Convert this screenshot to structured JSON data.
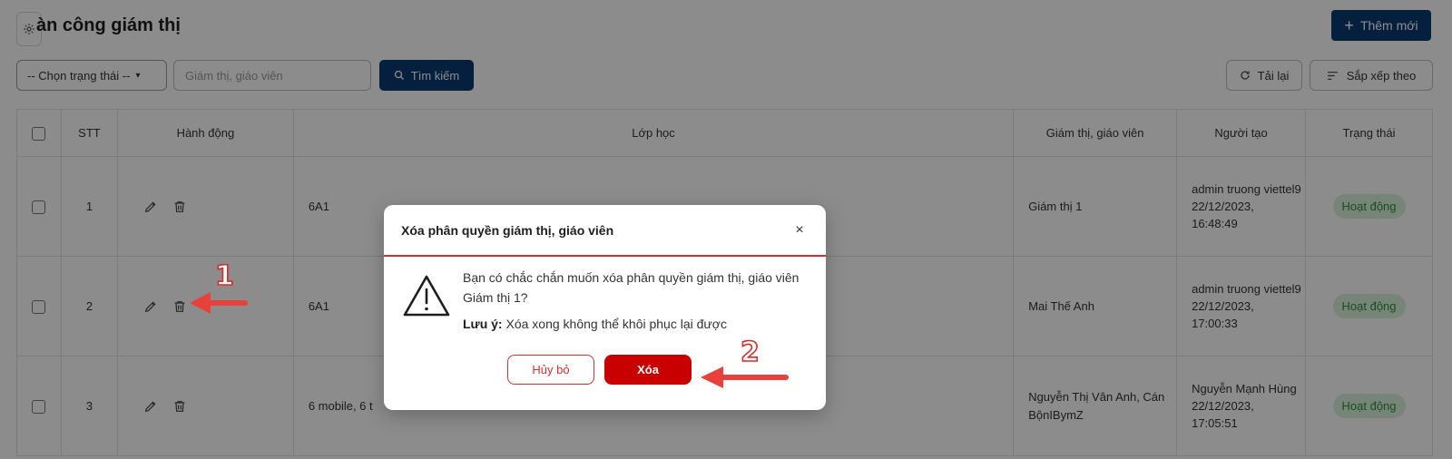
{
  "header": {
    "title": "àn công giám thị",
    "add_label": "Thêm mới"
  },
  "filters": {
    "status_selected": "-- Chọn trạng thái --",
    "search_placeholder": "Giám thị, giáo viên",
    "search_label": "Tìm kiếm",
    "reload_label": "Tải lại",
    "sort_label": "Sắp xếp theo"
  },
  "table": {
    "headers": {
      "stt": "STT",
      "action": "Hành động",
      "class": "Lớp học",
      "supervisor": "Giám thị, giáo viên",
      "creator": "Người tạo",
      "status": "Trạng thái"
    },
    "rows": [
      {
        "stt": "1",
        "class": "6A1",
        "supervisor": "Giám thị 1",
        "creator_name": "admin truong viettel9",
        "creator_date": "22/12/2023,",
        "creator_time": "16:48:49",
        "status": "Hoạt động"
      },
      {
        "stt": "2",
        "class": "6A1",
        "supervisor": "Mai Thế Anh",
        "creator_name": "admin truong viettel9",
        "creator_date": "22/12/2023,",
        "creator_time": "17:00:33",
        "status": "Hoạt động"
      },
      {
        "stt": "3",
        "class": "6 mobile, 6 t",
        "supervisor": "Nguyễn Thị Vân Anh, Cán BộnIBymZ",
        "creator_name": "Nguyễn Mạnh Hùng",
        "creator_date": "22/12/2023,",
        "creator_time": "17:05:51",
        "status": "Hoạt động"
      }
    ]
  },
  "modal": {
    "title": "Xóa phân quyền giám thị, giáo viên",
    "close_symbol": "×",
    "message": "Bạn có chắc chắn muốn xóa phân quyền giám thị, giáo viên Giám thị 1?",
    "note_label": "Lưu ý:",
    "note_text": " Xóa xong không thể khôi phục lại được",
    "cancel_label": "Hủy bỏ",
    "delete_label": "Xóa"
  },
  "annotations": {
    "step1": "1",
    "step2": "2"
  },
  "icons": {
    "gear": "gear-icon",
    "plus": "plus-icon",
    "search": "search-icon",
    "reload": "reload-icon",
    "sort": "sort-icon",
    "edit": "pencil-icon",
    "delete": "trash-icon",
    "warning": "warning-triangle-icon"
  },
  "colors": {
    "primary": "#0a3b73",
    "danger": "#c80000",
    "danger_border": "#d32f2f",
    "status_bg": "#d9f3dc",
    "status_text": "#2e8b42",
    "annotation_arrow": "#e8403a"
  }
}
